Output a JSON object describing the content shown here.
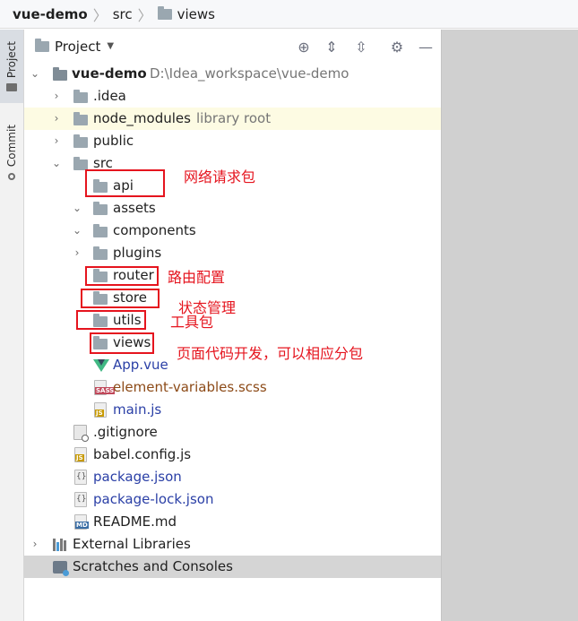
{
  "breadcrumb": {
    "project": "vue-demo",
    "folder1": "src",
    "folder2": "views"
  },
  "tool_strip": {
    "project_tab": "Project",
    "commit_tab": "Commit"
  },
  "panel": {
    "title": "Project",
    "icons": [
      "locate-icon",
      "expand-all-icon",
      "collapse-all-icon",
      "gear-icon",
      "minimize-icon"
    ]
  },
  "tree": {
    "root_name": "vue-demo",
    "root_path": "D:\\Idea_workspace\\vue-demo",
    "idea": ".idea",
    "node_modules": "node_modules",
    "node_modules_hint": "library root",
    "public": "public",
    "src": "src",
    "api": "api",
    "assets": "assets",
    "components": "components",
    "plugins": "plugins",
    "router": "router",
    "store": "store",
    "utils": "utils",
    "views": "views",
    "app_vue": "App.vue",
    "element_scss": "element-variables.scss",
    "main_js": "main.js",
    "gitignore": ".gitignore",
    "babel_config": "babel.config.js",
    "package_json": "package.json",
    "package_lock": "package-lock.json",
    "readme": "README.md",
    "external_libraries": "External Libraries",
    "scratches": "Scratches and Consoles"
  },
  "file_tags": {
    "js": "JS",
    "sass": "SASS",
    "md": "MD",
    "json": "{}"
  },
  "annotations": {
    "api_note": "网络请求包",
    "router_note": "路由配置",
    "store_note": "状态管理",
    "utils_note": "工具包",
    "views_note": "页面代码开发，可以相应分包"
  },
  "colors": {
    "annotation_red": "#e5141e",
    "link_blue": "#2a3fa6",
    "scss_brown": "#8c4a17",
    "library_highlight": "#fdfbe3",
    "selected_row": "#d5d5d5"
  }
}
